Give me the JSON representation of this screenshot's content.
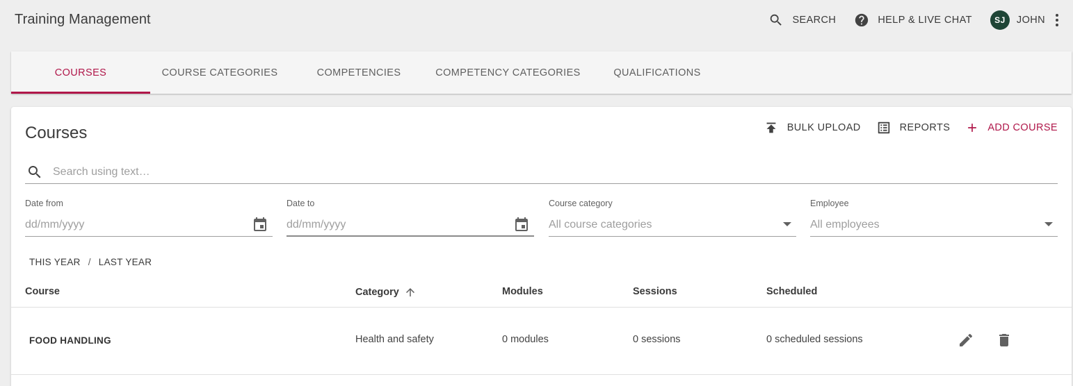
{
  "app": {
    "title": "Training Management"
  },
  "topbar": {
    "search_label": "SEARCH",
    "help_label": "HELP & LIVE CHAT",
    "user_initials": "SJ",
    "user_name": "JOHN"
  },
  "tabs": [
    {
      "label": "COURSES",
      "active": true
    },
    {
      "label": "COURSE CATEGORIES",
      "active": false
    },
    {
      "label": "COMPETENCIES",
      "active": false
    },
    {
      "label": "COMPETENCY CATEGORIES",
      "active": false
    },
    {
      "label": "QUALIFICATIONS",
      "active": false
    }
  ],
  "courses": {
    "title": "Courses",
    "actions": {
      "bulk_upload": "BULK UPLOAD",
      "reports": "REPORTS",
      "add_course": "ADD COURSE"
    },
    "search": {
      "placeholder": "Search using text…",
      "value": ""
    },
    "filters": {
      "date_from": {
        "label": "Date from",
        "placeholder": "dd/mm/yyyy"
      },
      "date_to": {
        "label": "Date to",
        "placeholder": "dd/mm/yyyy"
      },
      "course_category": {
        "label": "Course category",
        "value": "All course categories"
      },
      "employee": {
        "label": "Employee",
        "value": "All employees"
      }
    },
    "quick_ranges": {
      "this_year": "THIS YEAR",
      "separator": "/",
      "last_year": "LAST YEAR"
    },
    "table": {
      "columns": {
        "course": "Course",
        "category": "Category",
        "modules": "Modules",
        "sessions": "Sessions",
        "scheduled": "Scheduled"
      },
      "sort": {
        "column": "category",
        "direction": "ascending"
      },
      "rows": [
        {
          "course": "FOOD HANDLING",
          "category": "Health and safety",
          "modules": "0 modules",
          "sessions": "0 sessions",
          "scheduled": "0 scheduled sessions"
        }
      ]
    }
  },
  "colors": {
    "accent": "#b0174a",
    "background": "#eeeeee",
    "avatar": "#1f4536"
  }
}
